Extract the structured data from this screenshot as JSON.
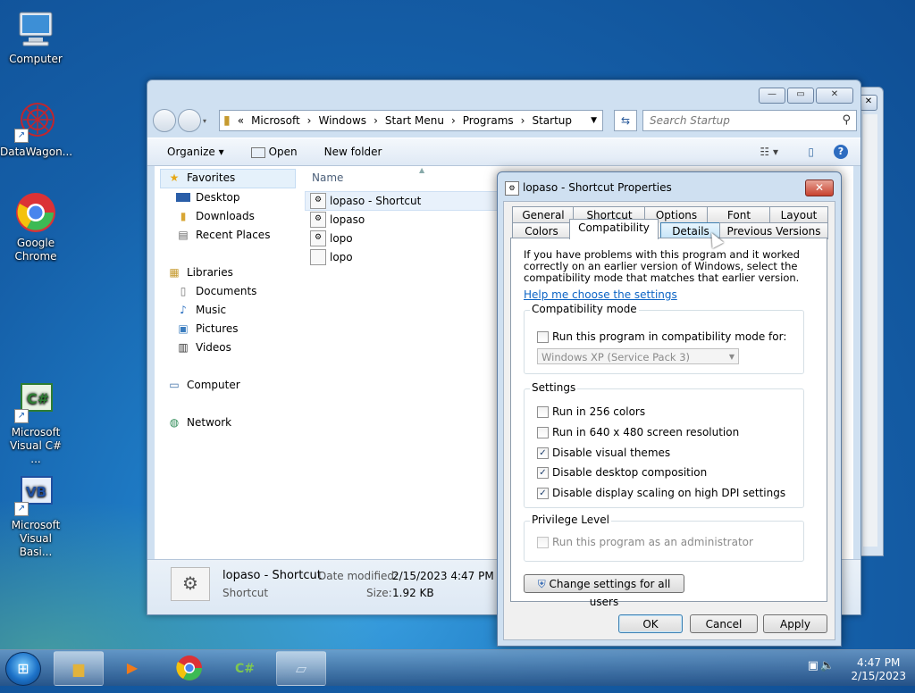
{
  "desktop": {
    "icons": [
      {
        "label": "Computer"
      },
      {
        "label": "DataWagon..."
      },
      {
        "label": "Google Chrome"
      },
      {
        "label": "Microsoft Visual C# ..."
      },
      {
        "label": "Microsoft Visual Basi..."
      }
    ]
  },
  "explorer": {
    "address": {
      "prefix": "«",
      "crumbs": [
        "Microsoft",
        "Windows",
        "Start Menu",
        "Programs",
        "Startup"
      ],
      "separator": "›"
    },
    "search_placeholder": "Search Startup",
    "toolbar": {
      "organize": "Organize ▾",
      "open": "Open",
      "new_folder": "New folder"
    },
    "nav": {
      "favorites": "Favorites",
      "desktop": "Desktop",
      "downloads": "Downloads",
      "recent": "Recent Places",
      "libraries": "Libraries",
      "documents": "Documents",
      "music": "Music",
      "pictures": "Pictures",
      "videos": "Videos",
      "computer": "Computer",
      "network": "Network"
    },
    "column_name": "Name",
    "files": [
      "lopaso - Shortcut",
      "lopaso",
      "lopo",
      "lopo"
    ],
    "details": {
      "name": "lopaso - Shortcut",
      "type": "Shortcut",
      "modified_label": "Date modified:",
      "modified_value": "2/15/2023 4:47 PM",
      "size_label": "Size:",
      "size_value": "1.92 KB"
    }
  },
  "dialog": {
    "title": "lopaso - Shortcut Properties",
    "tabs_row1": [
      "General",
      "Shortcut",
      "Options",
      "Font",
      "Layout"
    ],
    "tabs_row2": [
      "Colors",
      "Compatibility",
      "Details",
      "Previous Versions"
    ],
    "active_tab": "Compatibility",
    "intro": "If you have problems with this program and it worked correctly on an earlier version of Windows, select the compatibility mode that matches that earlier version.",
    "help_link": "Help me choose the settings",
    "compat_group": {
      "legend": "Compatibility mode",
      "checkbox": "Run this program in compatibility mode for:",
      "checked": false,
      "combo_value": "Windows XP (Service Pack 3)"
    },
    "settings_group": {
      "legend": "Settings",
      "options": [
        {
          "label": "Run in 256 colors",
          "checked": false
        },
        {
          "label": "Run in 640 x 480 screen resolution",
          "checked": false
        },
        {
          "label": "Disable visual themes",
          "checked": true
        },
        {
          "label": "Disable desktop composition",
          "checked": true
        },
        {
          "label": "Disable display scaling on high DPI settings",
          "checked": true
        }
      ]
    },
    "privilege_group": {
      "legend": "Privilege Level",
      "checkbox": "Run this program as an administrator",
      "checked": false
    },
    "change_all_users": "Change settings for all users",
    "buttons": {
      "ok": "OK",
      "cancel": "Cancel",
      "apply": "Apply"
    }
  },
  "taskbar": {
    "time": "4:47 PM",
    "date": "2/15/2023"
  }
}
